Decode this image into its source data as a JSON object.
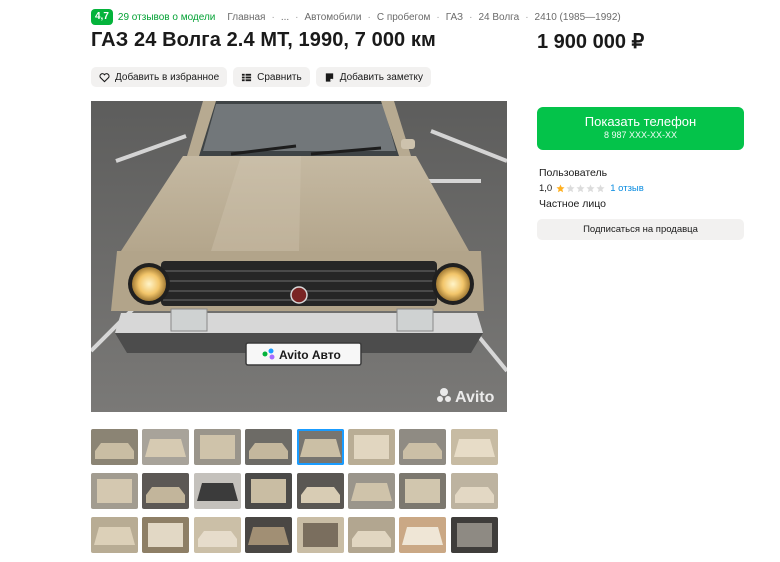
{
  "header": {
    "rating": "4,7",
    "reviews_link": "29 отзывов о модели",
    "breadcrumbs": [
      "Главная",
      "...",
      "Автомобили",
      "С пробегом",
      "ГАЗ",
      "24 Волга",
      "2410 (1985—1992)"
    ]
  },
  "listing": {
    "title": "ГАЗ 24 Волга 2.4 MT, 1990, 7 000 км",
    "price": "1 900 000 ₽"
  },
  "actions": {
    "favorite": "Добавить в избранное",
    "compare": "Сравнить",
    "note": "Добавить заметку"
  },
  "photo": {
    "plate_text": "Avito Авто",
    "watermark": "Avito",
    "thumbnail_count": 24,
    "active_thumbnail": 5
  },
  "contact": {
    "show_phone": "Показать телефон",
    "phone_masked": "8 987 XXX-XX-XX"
  },
  "seller": {
    "name": "Пользователь",
    "rating": "1,0",
    "rating_stars": 1,
    "reviews": "1 отзыв",
    "type": "Частное лицо",
    "subscribe": "Подписаться на продавца"
  },
  "colors": {
    "accent_green": "#04c34a",
    "rating_green": "#04b33b",
    "link_blue": "#0a8ce0",
    "star_gold": "#ffb021",
    "button_gray": "#f2f1f0"
  }
}
